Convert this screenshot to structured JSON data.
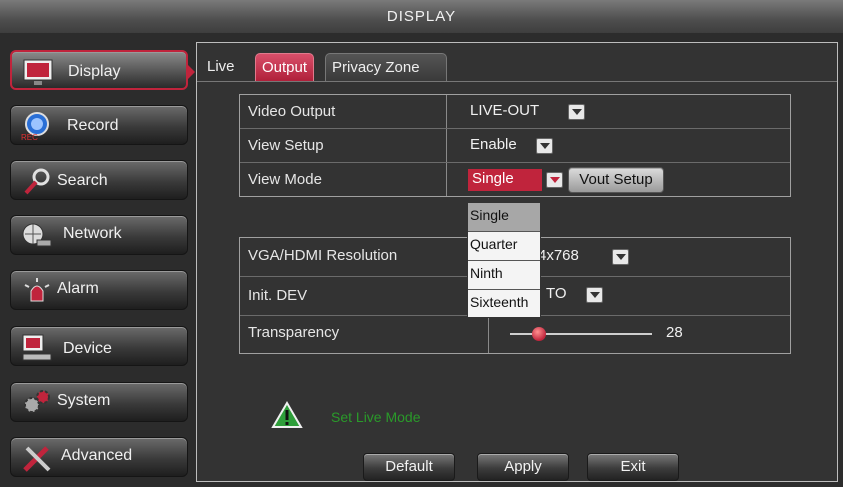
{
  "window": {
    "title": "DISPLAY"
  },
  "sidebar": {
    "items": [
      {
        "label": "Display",
        "icon": "monitor-icon",
        "active": true
      },
      {
        "label": "Record",
        "icon": "record-icon",
        "active": false,
        "sub": "REC"
      },
      {
        "label": "Search",
        "icon": "magnifier-icon",
        "active": false
      },
      {
        "label": "Network",
        "icon": "network-icon",
        "active": false
      },
      {
        "label": "Alarm",
        "icon": "alarm-icon",
        "active": false
      },
      {
        "label": "Device",
        "icon": "device-icon",
        "active": false
      },
      {
        "label": "System",
        "icon": "gears-icon",
        "active": false
      },
      {
        "label": "Advanced",
        "icon": "tools-icon",
        "active": false
      }
    ]
  },
  "tabs": [
    {
      "label": "Live",
      "active": false
    },
    {
      "label": "Output",
      "active": true
    },
    {
      "label": "Privacy Zone",
      "active": false
    }
  ],
  "output": {
    "video_output_label": "Video Output",
    "video_output_value": "LIVE-OUT",
    "view_setup_label": "View Setup",
    "view_setup_value": "Enable",
    "view_mode_label": "View Mode",
    "view_mode_value": "Single",
    "vout_setup_label": "Vout Setup",
    "view_mode_options": [
      "Single",
      "Quarter",
      "Ninth",
      "Sixteenth"
    ],
    "vga_label": "VGA/HDMI Resolution",
    "vga_value_visible": "4x768",
    "init_dev_label": "Init. DEV",
    "init_dev_value_visible": "TO",
    "transparency_label": "Transparency",
    "transparency_value": "28"
  },
  "status": {
    "message": "Set Live Mode",
    "icon": "warning-icon"
  },
  "footer": {
    "default_label": "Default",
    "apply_label": "Apply",
    "exit_label": "Exit"
  },
  "colors": {
    "accent": "#c0243c",
    "message": "#2a9a2a"
  }
}
